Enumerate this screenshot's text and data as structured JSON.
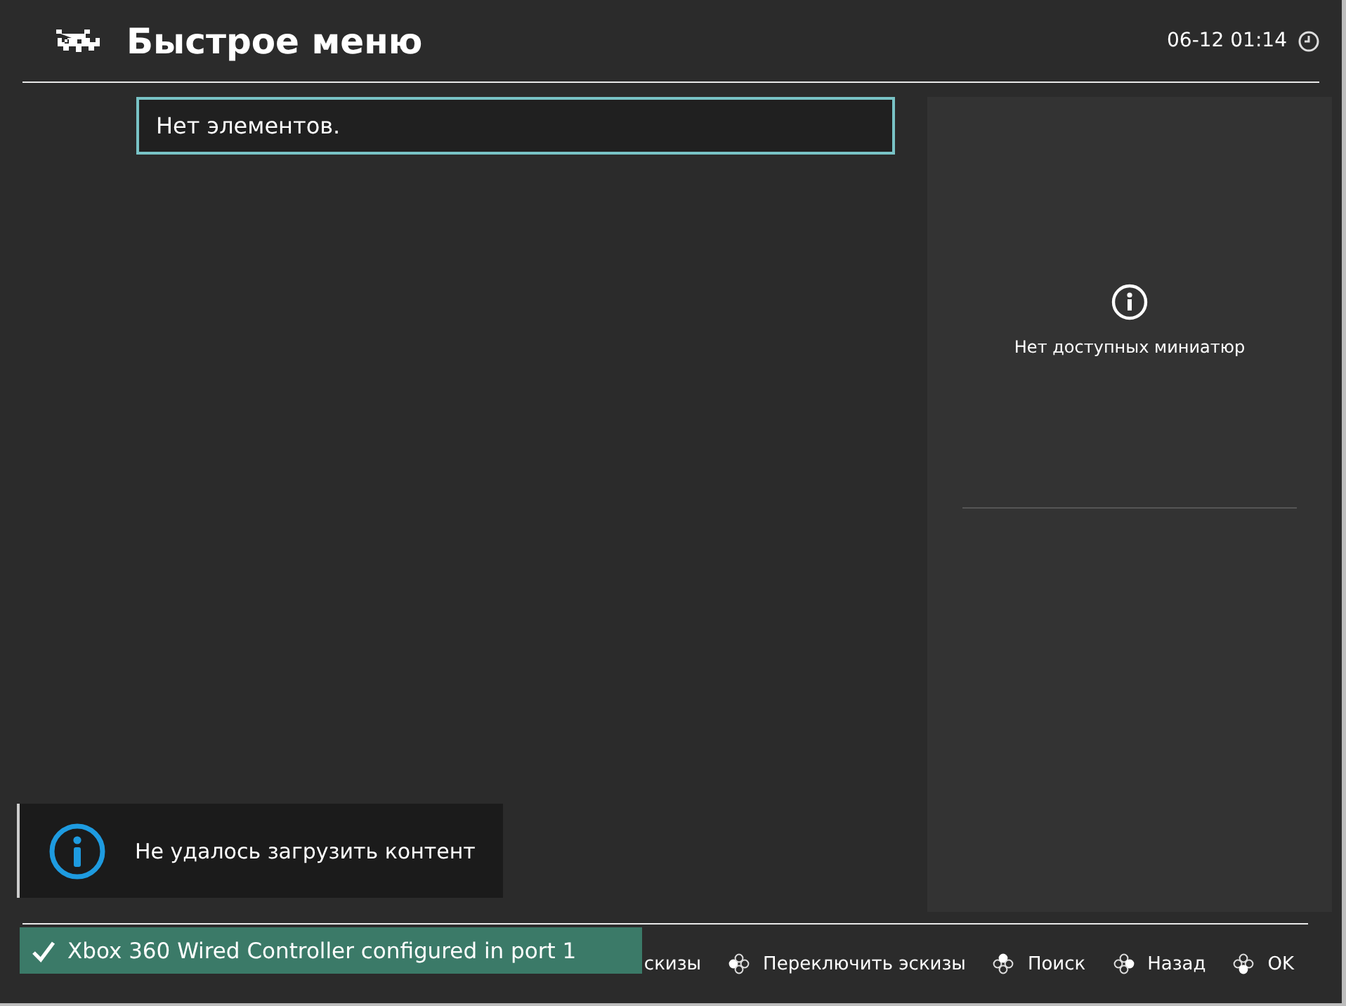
{
  "header": {
    "title": "Быстрое меню",
    "clock": "06-12 01:14"
  },
  "list": {
    "items": [
      {
        "label": "Нет элементов.",
        "selected": true
      }
    ]
  },
  "thumbnails": {
    "message": "Нет доступных миниатюр"
  },
  "notifications": [
    {
      "kind": "info",
      "text": "Не удалось загрузить контент"
    },
    {
      "kind": "success",
      "text": "Xbox 360 Wired Controller configured in port 1"
    }
  ],
  "footer_hints": [
    {
      "label": "скизы"
    },
    {
      "kind": "left",
      "label": "Переключить эскизы"
    },
    {
      "kind": "up",
      "label": "Поиск"
    },
    {
      "kind": "right",
      "label": "Назад"
    },
    {
      "kind": "down",
      "label": "OK"
    }
  ]
}
